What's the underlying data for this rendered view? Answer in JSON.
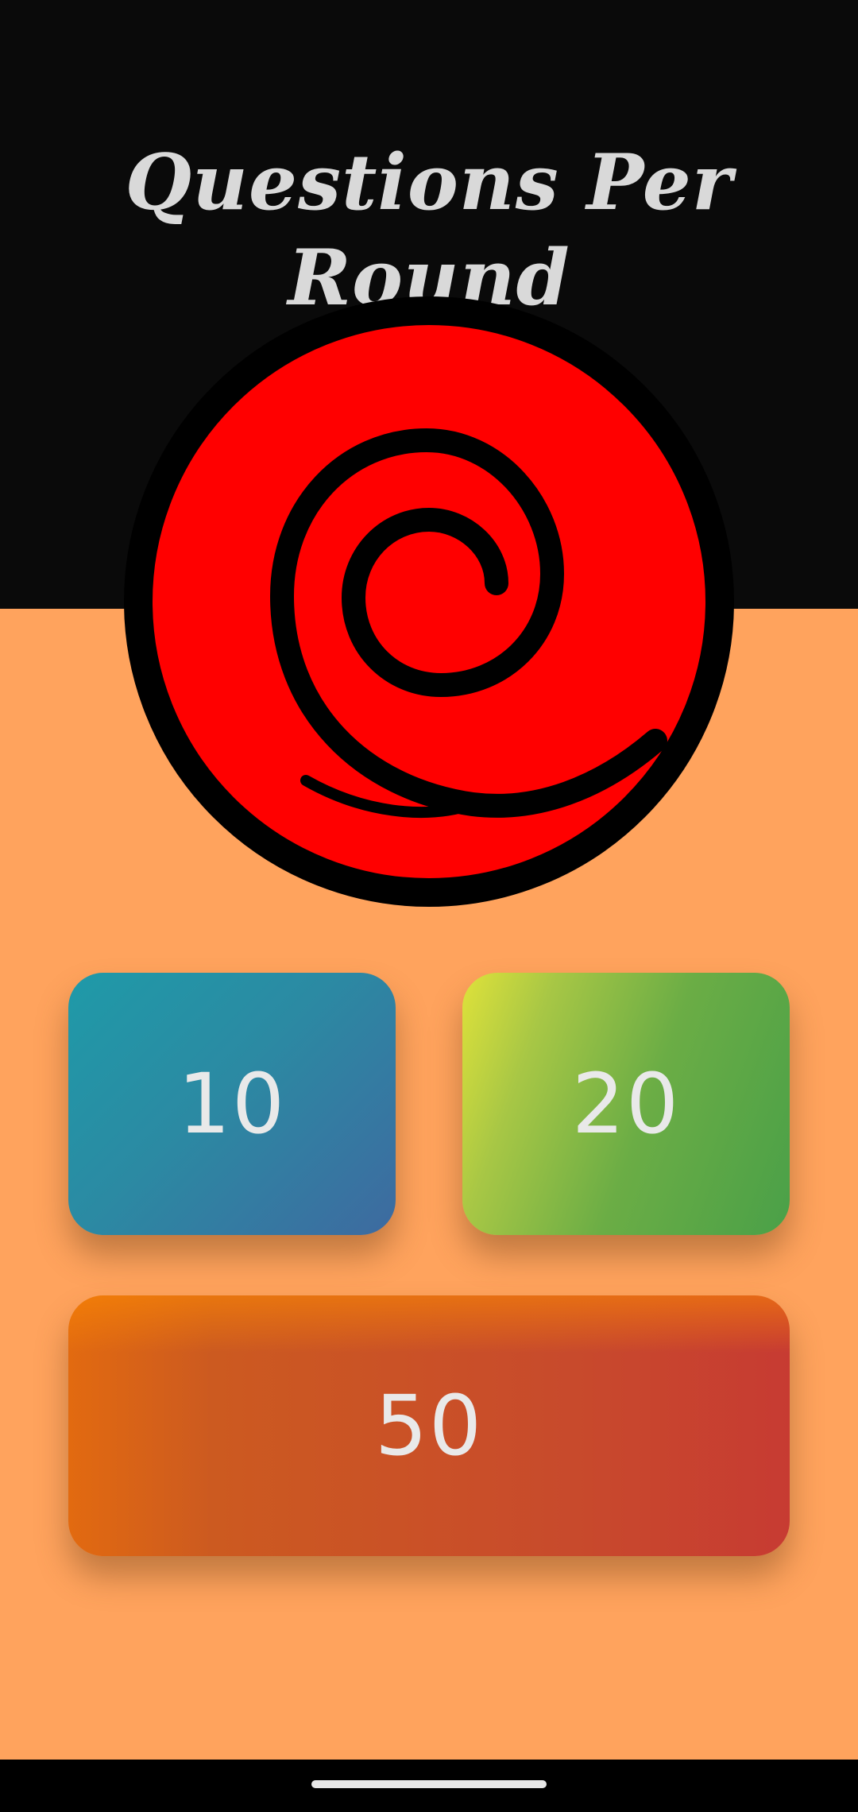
{
  "screen": {
    "title": "Questions Per Round"
  },
  "emblem": {
    "icon": "spiral-icon",
    "fill_color": "#ff0000",
    "stroke_color": "#000000"
  },
  "options": {
    "ten": "10",
    "twenty": "20",
    "fifty": "50"
  },
  "colors": {
    "top_background": "#0a0a0a",
    "bottom_background": "#ffa35d",
    "title_text": "#d9d9d9",
    "button_text": "#e9e9e9"
  }
}
